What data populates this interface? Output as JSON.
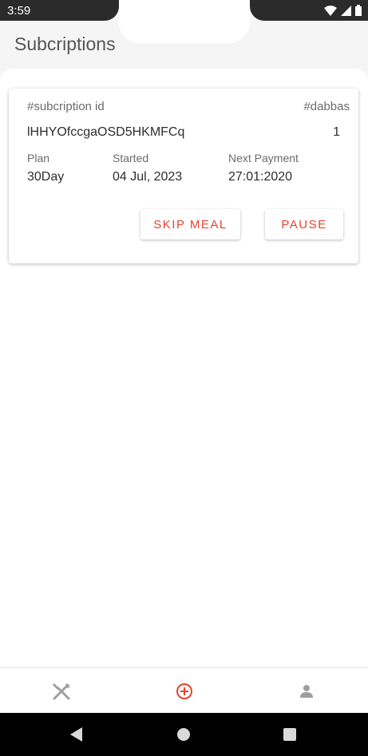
{
  "status_bar": {
    "time": "3:59",
    "icons": [
      "wifi-icon",
      "signal-icon",
      "battery-icon"
    ]
  },
  "header": {
    "title": "Subcriptions"
  },
  "subscription_card": {
    "id_label": "#subcription id",
    "dabbas_label": "#dabbas",
    "id_value": "lHHYOfccgaOSD5HKMFCq",
    "dabbas_value": "1",
    "plan_label": "Plan",
    "plan_value": "30Day",
    "started_label": "Started",
    "started_value": "04 Jul, 2023",
    "next_payment_label": "Next Payment",
    "next_payment_value": "27:01:2020",
    "skip_meal_label": "SKIP MEAL",
    "pause_label": "PAUSE"
  },
  "bottom_nav": {
    "items": [
      {
        "icon": "utensils-icon",
        "active": false
      },
      {
        "icon": "add-circle-icon",
        "active": true
      },
      {
        "icon": "person-icon",
        "active": false
      }
    ]
  },
  "colors": {
    "accent": "#e8422e",
    "inactive_icon": "#9e9e9e",
    "status_bar_dark": "#2b2b2b"
  }
}
